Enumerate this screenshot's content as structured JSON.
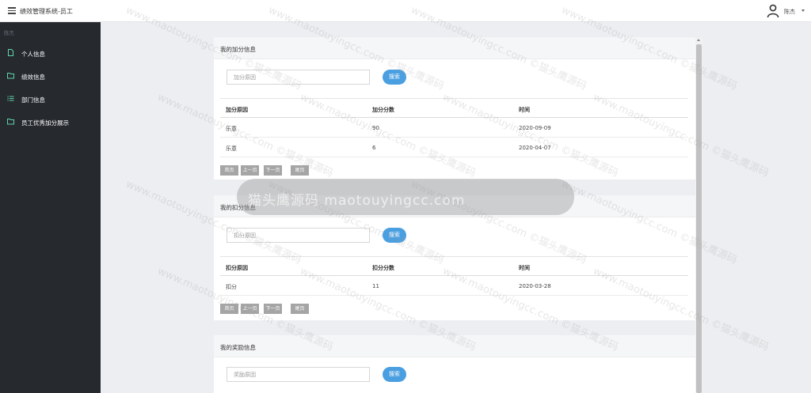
{
  "header": {
    "app_title": "绩效管理系统-员工",
    "user_name": "陈杰"
  },
  "sidebar": {
    "header": "陈杰",
    "items": [
      {
        "label": "个人信息",
        "icon": "file-icon"
      },
      {
        "label": "绩效信息",
        "icon": "folder-icon"
      },
      {
        "label": "部门信息",
        "icon": "list-icon"
      },
      {
        "label": "员工优秀加分展示",
        "icon": "folder-icon"
      }
    ]
  },
  "cards": [
    {
      "title": "我的加分信息",
      "search_placeholder": "加分原因",
      "search_label": "搜索",
      "columns": [
        "加分原因",
        "加分分数",
        "时间"
      ],
      "rows": [
        [
          "乐意",
          "90",
          "2020-09-09"
        ],
        [
          "乐意",
          "6",
          "2020-04-07"
        ]
      ],
      "pager": [
        "首页",
        "上一页",
        "下一页",
        "尾页"
      ]
    },
    {
      "title": "我的扣分信息",
      "search_placeholder": "扣分原因",
      "search_label": "搜索",
      "columns": [
        "扣分原因",
        "扣分分数",
        "时间"
      ],
      "rows": [
        [
          "扣分",
          "11",
          "2020-03-28"
        ]
      ],
      "pager": [
        "首页",
        "上一页",
        "下一页",
        "尾页"
      ]
    },
    {
      "title": "我的奖励信息",
      "search_placeholder": "奖励原因",
      "search_label": "搜索"
    }
  ],
  "watermark": {
    "band_text": "猫头鹰源码 maotouyingcc.com",
    "tile_text": "www.maotouyingcc.com ©猫头鹰源码"
  },
  "colors": {
    "sidebar_bg": "#262a2f",
    "accent": "#4a9fe0",
    "nav_icon": "#5fd3a8",
    "pager_bg": "#a5a5a5"
  }
}
